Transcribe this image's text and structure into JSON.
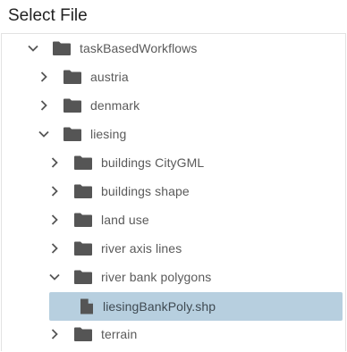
{
  "dialog": {
    "title": "Select File"
  },
  "tree": {
    "root": {
      "label": "taskBasedWorkflows",
      "expanded": true
    },
    "items": [
      {
        "label": "austria",
        "expanded": false
      },
      {
        "label": "denmark",
        "expanded": false
      },
      {
        "label": "liesing",
        "expanded": true
      },
      {
        "label": "buildings CityGML",
        "expanded": false
      },
      {
        "label": "buildings shape",
        "expanded": false
      },
      {
        "label": "land use",
        "expanded": false
      },
      {
        "label": "river axis lines",
        "expanded": false
      },
      {
        "label": "river bank polygons",
        "expanded": true
      },
      {
        "label": "liesingBankPoly.shp",
        "selected": true
      },
      {
        "label": "terrain",
        "expanded": false
      }
    ]
  },
  "colors": {
    "selection": "#b7cfdf",
    "icon": "#555555"
  }
}
